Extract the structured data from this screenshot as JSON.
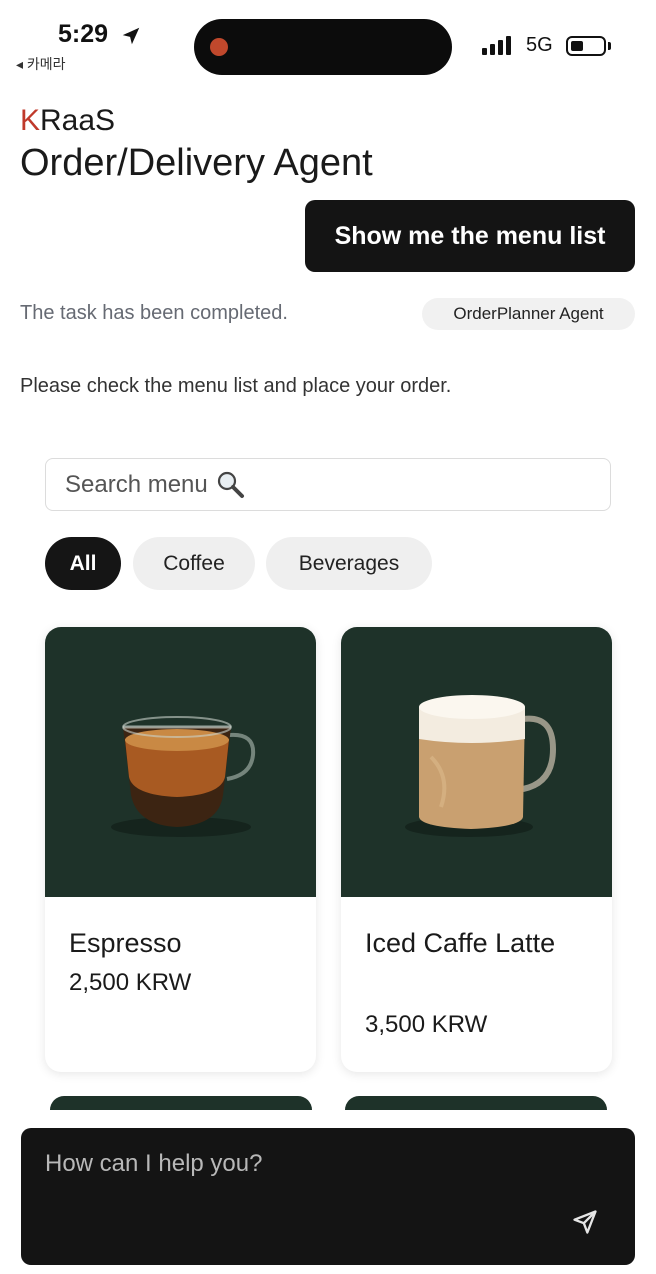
{
  "status_bar": {
    "time": "5:29",
    "back_app": "◂ 카메라",
    "network": "5G"
  },
  "header": {
    "brand_k": "K",
    "brand_name": "RaaS",
    "title": "Order/Delivery Agent"
  },
  "chat": {
    "user_message": "Show me the menu list",
    "task_status": "The task has been completed.",
    "agent_badge": "OrderPlanner Agent",
    "agent_message": "Please check the menu list and place your order."
  },
  "search": {
    "placeholder": "Search menu"
  },
  "filters": [
    {
      "label": "All",
      "selected": true
    },
    {
      "label": "Coffee",
      "selected": false
    },
    {
      "label": "Beverages",
      "selected": false
    }
  ],
  "menu_items": [
    {
      "name": "Espresso",
      "price": "2,500 KRW"
    },
    {
      "name": "Iced Caffe Latte",
      "price": "3,500 KRW"
    }
  ],
  "input": {
    "placeholder": "How can I help you?"
  },
  "colors": {
    "accent_dark": "#141414",
    "brand_red": "#c0392b",
    "card_image_bg": "#1e3229"
  }
}
